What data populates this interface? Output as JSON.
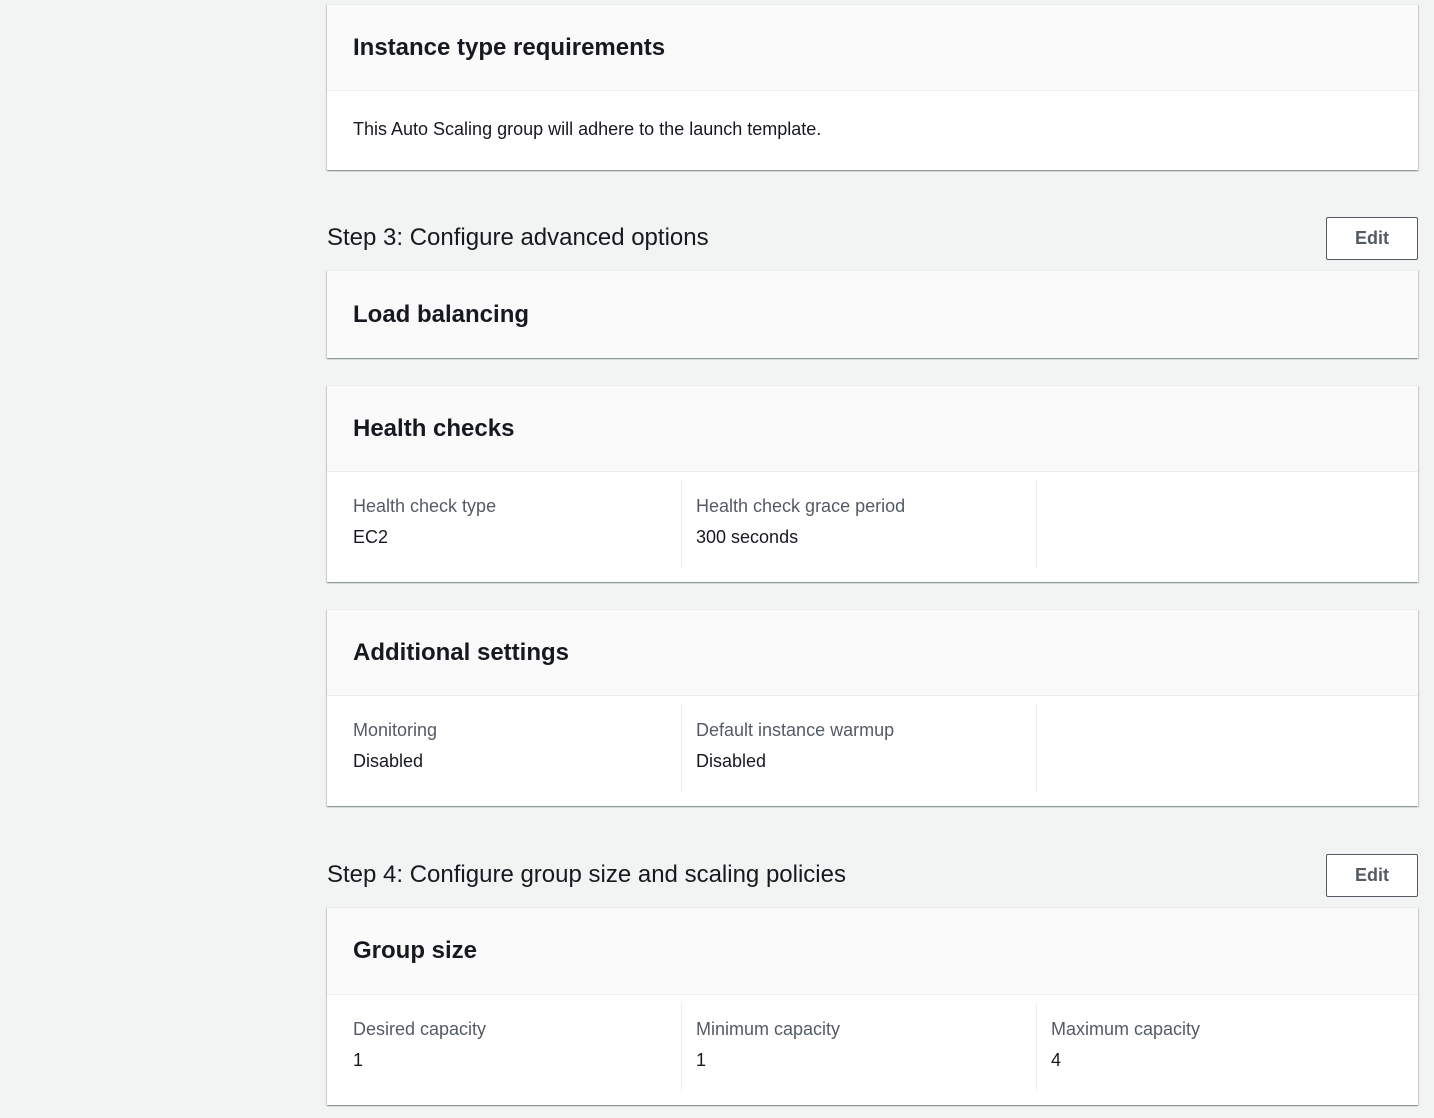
{
  "instance_type_requirements": {
    "title": "Instance type requirements",
    "description": "This Auto Scaling group will adhere to the launch template."
  },
  "step3": {
    "title": "Step 3: Configure advanced options",
    "edit_label": "Edit",
    "load_balancing": {
      "title": "Load balancing"
    },
    "health_checks": {
      "title": "Health checks",
      "fields": [
        {
          "label": "Health check type",
          "value": "EC2"
        },
        {
          "label": "Health check grace period",
          "value": "300 seconds"
        }
      ]
    },
    "additional_settings": {
      "title": "Additional settings",
      "fields": [
        {
          "label": "Monitoring",
          "value": "Disabled"
        },
        {
          "label": "Default instance warmup",
          "value": "Disabled"
        }
      ]
    }
  },
  "step4": {
    "title": "Step 4: Configure group size and scaling policies",
    "edit_label": "Edit",
    "group_size": {
      "title": "Group size",
      "fields": [
        {
          "label": "Desired capacity",
          "value": "1"
        },
        {
          "label": "Minimum capacity",
          "value": "1"
        },
        {
          "label": "Maximum capacity",
          "value": "4"
        }
      ]
    }
  }
}
